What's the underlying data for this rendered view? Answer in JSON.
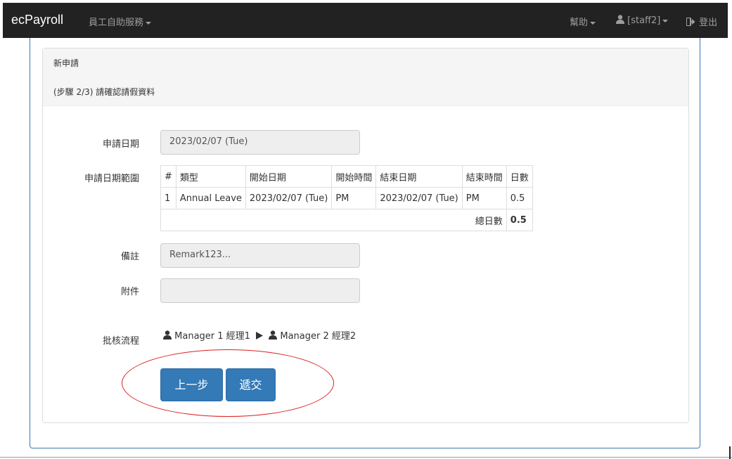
{
  "navbar": {
    "brand": "ecPayroll",
    "menu_self_service": "員工自助服務",
    "menu_help": "幫助",
    "user_label": "[staff2]",
    "logout_label": "登出"
  },
  "panel": {
    "title": "新申請",
    "subtitle": "(步驟 2/3) 請確認請假資料"
  },
  "form": {
    "apply_date_label": "申請日期",
    "apply_date_value": "2023/02/07 (Tue)",
    "date_range_label": "申請日期範圍",
    "remarks_label": "備註",
    "remarks_value": "Remark123...",
    "attachment_label": "附件",
    "attachment_value": "",
    "approval_label": "批核流程"
  },
  "table": {
    "headers": [
      "#",
      "類型",
      "開始日期",
      "開始時間",
      "結束日期",
      "結束時間",
      "日數"
    ],
    "rows": [
      [
        "1",
        "Annual Leave",
        "2023/02/07 (Tue)",
        "PM",
        "2023/02/07 (Tue)",
        "PM",
        "0.5"
      ]
    ],
    "total_label": "總日數",
    "total_value": "0.5"
  },
  "approval_flow": {
    "step1": "Manager 1 經理1",
    "step2": "Manager 2 經理2"
  },
  "buttons": {
    "back": "上一步",
    "submit": "遞交"
  },
  "colors": {
    "navbar_bg": "#222222",
    "primary": "#337ab7",
    "highlight_ellipse": "#d9201f"
  }
}
